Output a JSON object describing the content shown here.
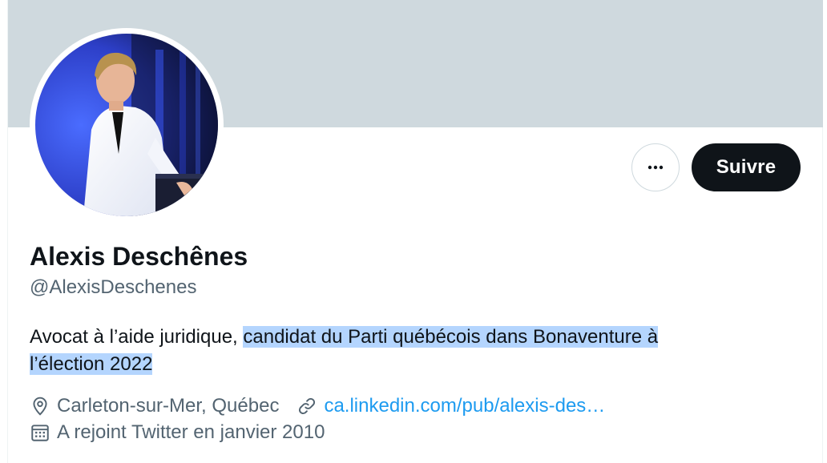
{
  "profile": {
    "name": "Alexis Deschênes",
    "handle": "@AlexisDeschenes",
    "bio_plain": "Avocat à l’aide juridique, ",
    "bio_highlight_line1": "candidat du Parti québécois dans Bonaventure à ",
    "bio_highlight_line2": "l’élection 2022",
    "location": "Carleton-sur-Mer, Québec",
    "website": "ca.linkedin.com/pub/alexis-des…",
    "joined": "A rejoint Twitter en janvier 2010"
  },
  "actions": {
    "follow_label": "Suivre",
    "more_icon": "more-horizontal-icon"
  },
  "colors": {
    "banner": "#cfd9de",
    "follow_bg": "#0f1419",
    "link": "#1d9bf0",
    "secondary_text": "#536471",
    "selection": "#b4d5fe"
  },
  "icons": {
    "location": "location-pin-icon",
    "website": "link-icon",
    "joined": "calendar-icon"
  }
}
